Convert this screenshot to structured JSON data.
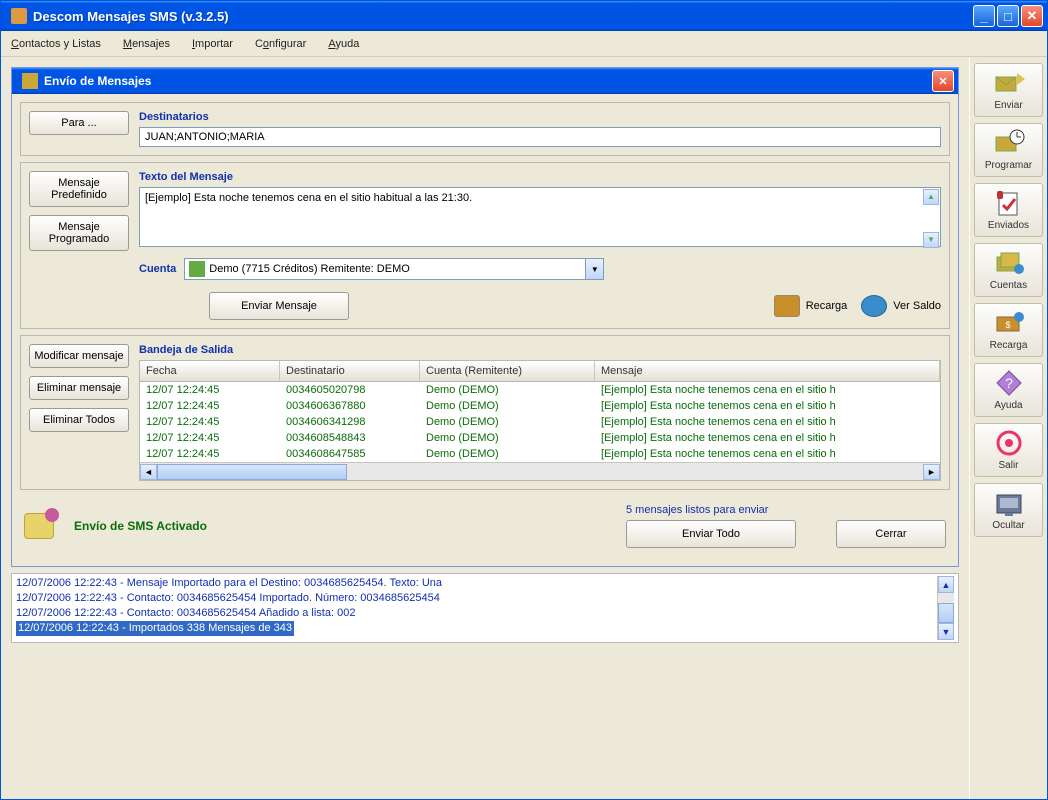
{
  "window": {
    "title": "Descom Mensajes SMS (v.3.2.5)"
  },
  "menubar": [
    {
      "label": "Contactos y Listas",
      "u": "C"
    },
    {
      "label": "Mensajes",
      "u": "M"
    },
    {
      "label": "Importar",
      "u": "I"
    },
    {
      "label": "Configurar",
      "u": "o"
    },
    {
      "label": "Ayuda",
      "u": "A"
    }
  ],
  "inner": {
    "title": "Envío de Mensajes",
    "para_btn": "Para ...",
    "destinatarios_label": "Destinatarios",
    "destinatarios_value": "JUAN;ANTONIO;MARIA",
    "msg_predef_btn": "Mensaje Predefinido",
    "msg_prog_btn": "Mensaje Programado",
    "texto_label": "Texto del Mensaje",
    "texto_value": "[Ejemplo] Esta noche tenemos cena en el sitio habitual a las 21:30.",
    "cuenta_label": "Cuenta",
    "cuenta_value": "Demo   (7715 Créditos)   Remitente: DEMO",
    "enviar_btn": "Enviar Mensaje",
    "recarga_link": "Recarga",
    "ver_saldo_link": "Ver Saldo",
    "bandeja_label": "Bandeja de Salida",
    "modificar_btn": "Modificar mensaje",
    "eliminar_btn": "Eliminar mensaje",
    "eliminar_todos_btn": "Eliminar Todos",
    "table": {
      "headers": [
        "Fecha",
        "Destinatario",
        "Cuenta (Remitente)",
        "Mensaje"
      ],
      "rows": [
        [
          "12/07 12:24:45",
          "0034605020798",
          "Demo (DEMO)",
          "[Ejemplo] Esta noche tenemos cena en el sitio h"
        ],
        [
          "12/07 12:24:45",
          "0034606367880",
          "Demo (DEMO)",
          "[Ejemplo] Esta noche tenemos cena en el sitio h"
        ],
        [
          "12/07 12:24:45",
          "0034606341298",
          "Demo (DEMO)",
          "[Ejemplo] Esta noche tenemos cena en el sitio h"
        ],
        [
          "12/07 12:24:45",
          "0034608548843",
          "Demo (DEMO)",
          "[Ejemplo] Esta noche tenemos cena en el sitio h"
        ],
        [
          "12/07 12:24:45",
          "0034608647585",
          "Demo (DEMO)",
          "[Ejemplo] Esta noche tenemos cena en el sitio h"
        ]
      ]
    },
    "status_text": "Envío de SMS Activado",
    "ready_text": "5 mensajes listos para enviar",
    "enviar_todo_btn": "Enviar Todo",
    "cerrar_btn": "Cerrar"
  },
  "log": [
    "12/07/2006 12:22:43 - Mensaje Importado para el Destino: 0034685625454. Texto: Una",
    "12/07/2006 12:22:43 - Contacto: 0034685625454 Importado. Número: 0034685625454",
    "12/07/2006 12:22:43 - Contacto: 0034685625454 Añadido a lista: 002",
    "12/07/2006 12:22:43 - Importados 338 Mensajes de 343"
  ],
  "toolbar": [
    {
      "label": "Enviar",
      "icon": "send"
    },
    {
      "label": "Programar",
      "icon": "schedule"
    },
    {
      "label": "Enviados",
      "icon": "sent"
    },
    {
      "label": "Cuentas",
      "icon": "accounts"
    },
    {
      "label": "Recarga",
      "icon": "recharge"
    },
    {
      "label": "Ayuda",
      "icon": "help"
    },
    {
      "label": "Salir",
      "icon": "exit"
    },
    {
      "label": "Ocultar",
      "icon": "hide"
    }
  ]
}
